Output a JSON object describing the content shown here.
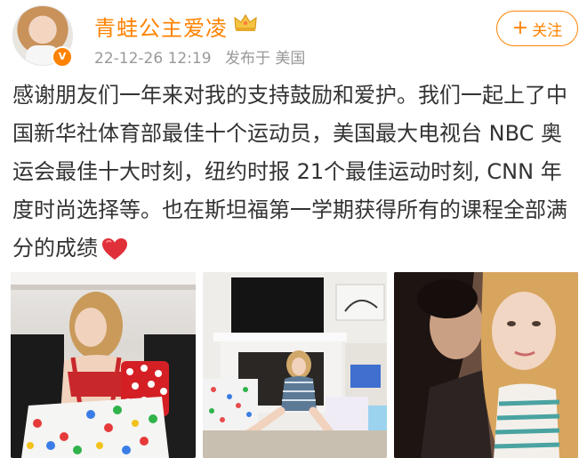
{
  "post": {
    "author": "青蛙公主爱凌",
    "timestamp": "22-12-26 12:19",
    "location": "发布于 美国",
    "follow_label": "关注",
    "text": "感谢朋友们一年来对我的支持鼓励和爱护。我们一起上了中国新华社体育部最佳十个运动员，美国最大电视台 NBC 奥运会最佳十大时刻，纽约时报 21个最佳运动时刻, CNN 年度时尚选择等。也在斯坦福第一学期获得所有的课程全部满分的成绩",
    "verified_badge": "V",
    "icons": [
      "crown-icon",
      "heart-emoji-icon",
      "verified-badge-icon"
    ],
    "brand_color": "#ff8200"
  },
  "photos": [
    {
      "name": "photo-handbag-gift"
    },
    {
      "name": "photo-living-room"
    },
    {
      "name": "photo-kiss-selfie"
    }
  ]
}
